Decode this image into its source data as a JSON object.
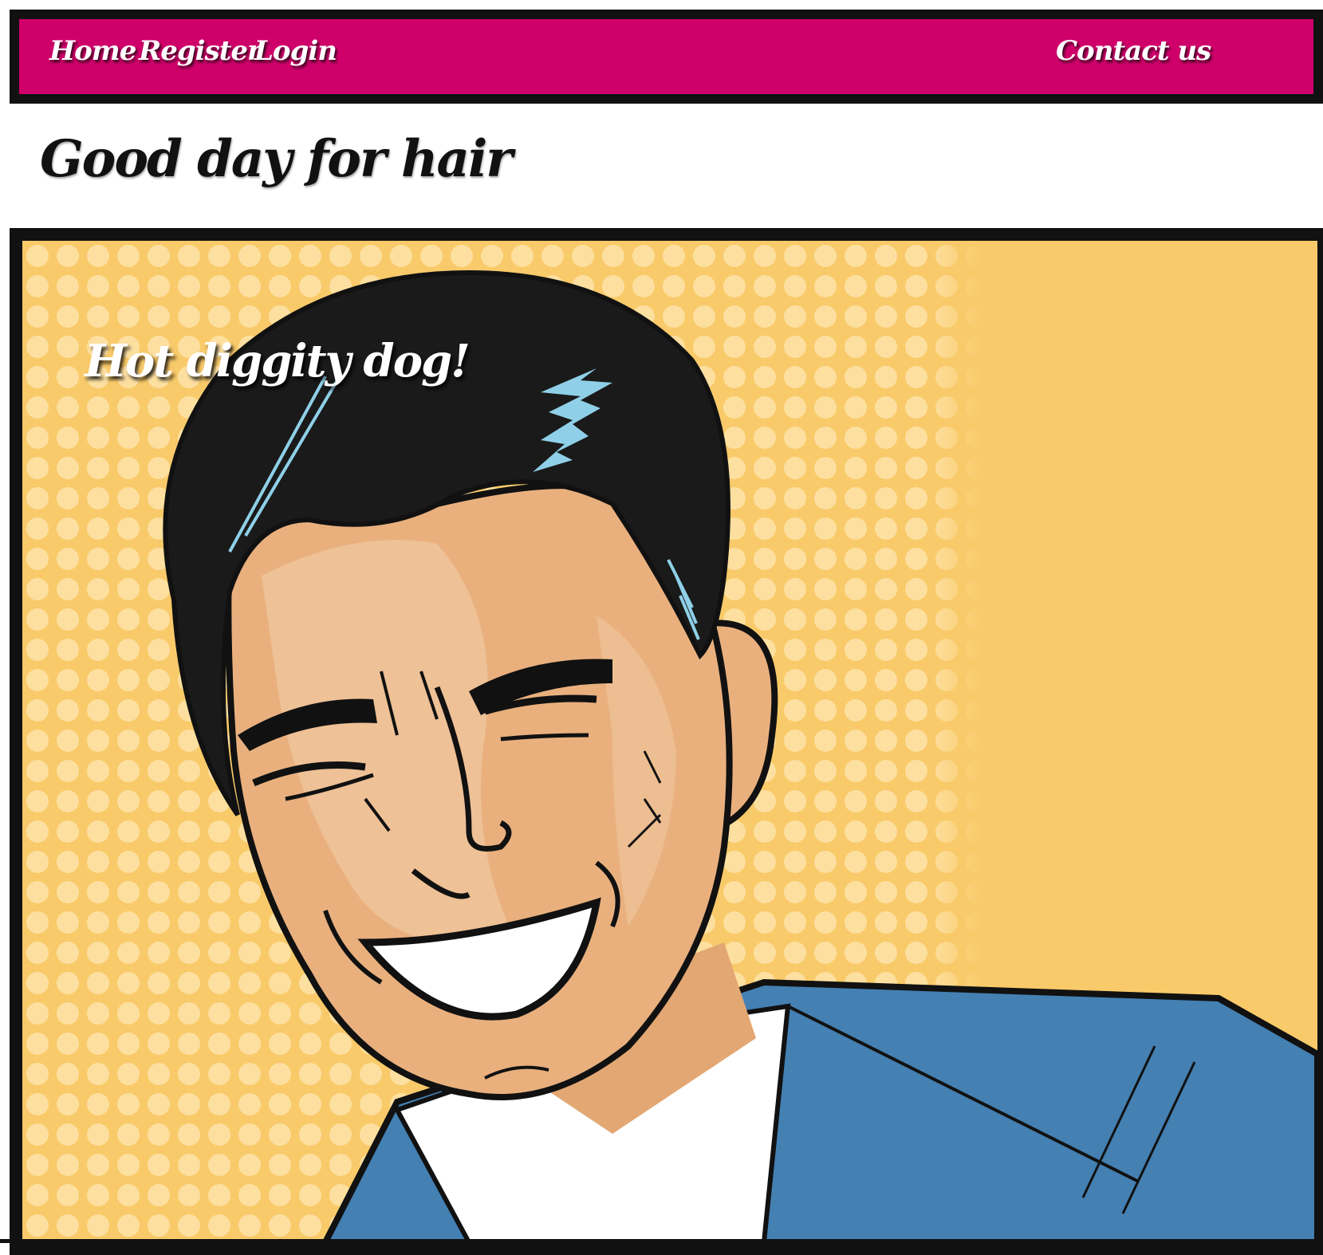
{
  "nav": {
    "home": "Home",
    "register": "Register",
    "login": "Login",
    "contact": "Contact us"
  },
  "page": {
    "title": "Good day for hair"
  },
  "hero": {
    "caption": "Hot diggity dog!",
    "illustration": "pop-art laughing man with black hair and blue suit on yellow polka-dot background"
  },
  "colors": {
    "nav_background": "#d0006b",
    "frame_border": "#111111",
    "hero_background": "#f9ca6a",
    "polka_dot": "#fde0a0",
    "suit": "#4480b2",
    "skin": "#e9b07e"
  }
}
